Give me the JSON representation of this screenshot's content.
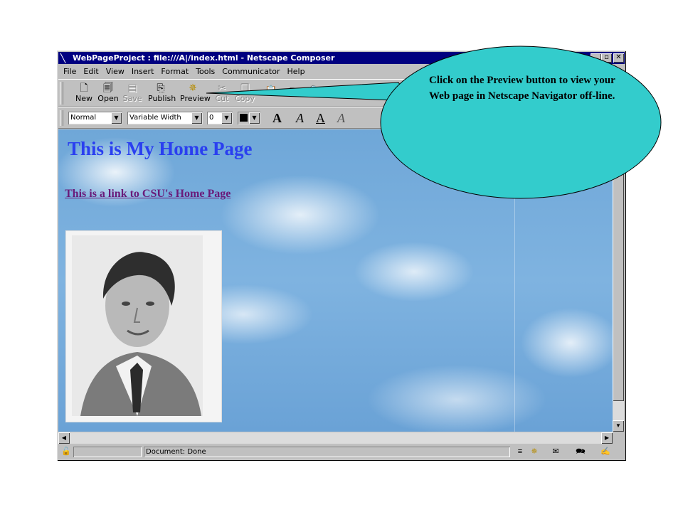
{
  "window": {
    "title": "WebPageProject : file:///A|/index.html - Netscape Composer",
    "controls": {
      "minimize": "_",
      "maximize": "▫",
      "close": "✕"
    }
  },
  "menubar": [
    "File",
    "Edit",
    "View",
    "Insert",
    "Format",
    "Tools",
    "Communicator",
    "Help"
  ],
  "toolbar": {
    "buttons": [
      {
        "label": "New",
        "icon": "new-doc-icon",
        "enabled": true
      },
      {
        "label": "Open",
        "icon": "open-icon",
        "enabled": true
      },
      {
        "label": "Save",
        "icon": "save-icon",
        "enabled": false
      },
      {
        "label": "Publish",
        "icon": "publish-icon",
        "enabled": true
      },
      {
        "label": "Preview",
        "icon": "preview-icon",
        "enabled": true
      },
      {
        "label": "Cut",
        "icon": "cut-icon",
        "enabled": false
      },
      {
        "label": "Copy",
        "icon": "copy-icon",
        "enabled": false
      }
    ]
  },
  "formatbar": {
    "paragraph_style": "Normal",
    "font": "Variable Width",
    "font_size": "0",
    "letters": [
      "A",
      "A",
      "A",
      "A"
    ]
  },
  "page": {
    "heading": "This is My Home Page",
    "link": "This is a link to CSU's Home Page",
    "link_color": "#6a1b7a",
    "heading_color": "#2a3ff0"
  },
  "status": {
    "text": "Document: Done"
  },
  "callout": {
    "text": "Click on the Preview button to view your Web page in Netscape Navigator off-line.",
    "color": "#33cccc"
  }
}
